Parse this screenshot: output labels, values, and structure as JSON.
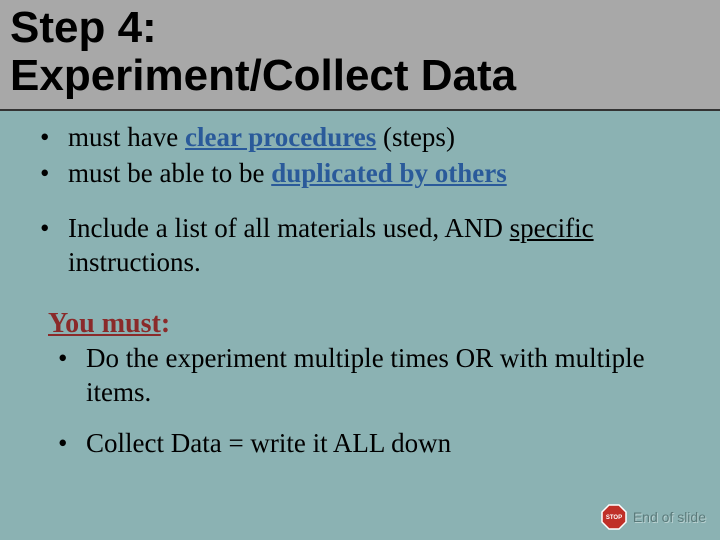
{
  "header": {
    "title_line1": "Step 4:",
    "title_line2": "Experiment/Collect Data"
  },
  "bullets": {
    "b1_pre": "must have ",
    "b1_emph": "clear procedures",
    "b1_post": "  (steps)",
    "b2_pre": "must be able to be ",
    "b2_emph": "duplicated by others",
    "b3_pre": "Include a list of all materials used, AND ",
    "b3_underline": "specific",
    "b3_post": " instructions."
  },
  "youmust": {
    "label": "You must",
    "colon": ":"
  },
  "sub": {
    "s1": "Do the experiment multiple times OR with multiple items.",
    "s2": "Collect Data = write it ALL down"
  },
  "footer": {
    "end": "End of slide",
    "stop_label": "STOP"
  }
}
